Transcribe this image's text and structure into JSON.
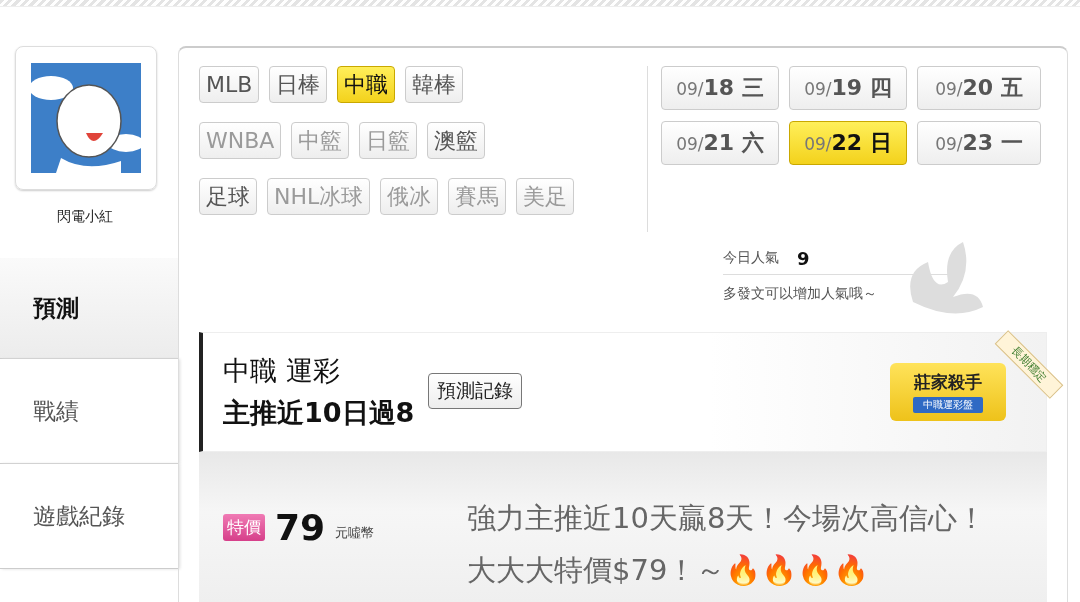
{
  "sidebar": {
    "user_name": "閃電小紅",
    "items": [
      {
        "label": "預測",
        "selected": true
      },
      {
        "label": "戰績",
        "selected": false
      },
      {
        "label": "遊戲紀錄",
        "selected": false
      }
    ]
  },
  "sport_rows": [
    [
      {
        "label": "MLB",
        "selected": false,
        "disabled": false
      },
      {
        "label": "日棒",
        "selected": false,
        "disabled": false
      },
      {
        "label": "中職",
        "selected": true,
        "disabled": false
      },
      {
        "label": "韓棒",
        "selected": false,
        "disabled": false
      }
    ],
    [
      {
        "label": "WNBA",
        "selected": false,
        "disabled": true
      },
      {
        "label": "中籃",
        "selected": false,
        "disabled": true
      },
      {
        "label": "日籃",
        "selected": false,
        "disabled": true
      },
      {
        "label": "澳籃",
        "selected": false,
        "disabled": false
      }
    ],
    [
      {
        "label": "足球",
        "selected": false,
        "disabled": false
      },
      {
        "label": "NHL冰球",
        "selected": false,
        "disabled": true
      },
      {
        "label": "俄冰",
        "selected": false,
        "disabled": true
      },
      {
        "label": "賽馬",
        "selected": false,
        "disabled": true
      },
      {
        "label": "美足",
        "selected": false,
        "disabled": true
      }
    ]
  ],
  "dates": [
    {
      "month": "09/",
      "day": "18",
      "weekday": "三",
      "selected": false
    },
    {
      "month": "09/",
      "day": "19",
      "weekday": "四",
      "selected": false
    },
    {
      "month": "09/",
      "day": "20",
      "weekday": "五",
      "selected": false
    },
    {
      "month": "09/",
      "day": "21",
      "weekday": "六",
      "selected": false
    },
    {
      "month": "09/",
      "day": "22",
      "weekday": "日",
      "selected": true
    },
    {
      "month": "09/",
      "day": "23",
      "weekday": "一",
      "selected": false
    }
  ],
  "popularity": {
    "label": "今日人氣",
    "value": "9",
    "hint": "多發文可以增加人氣哦～"
  },
  "prediction": {
    "title": "中職 運彩",
    "subtitle": "主推近10日過8",
    "record_button": "預測記錄",
    "badge": {
      "title": "莊家殺手",
      "subtitle": "中職運彩盤",
      "ribbon": "長期穩定"
    }
  },
  "offer": {
    "tag": "特價",
    "price": "79",
    "unit": "元噓幣",
    "description": "強力主推近10天贏8天！今場次高信心！大大大特價$79！～🔥🔥🔥🔥"
  }
}
